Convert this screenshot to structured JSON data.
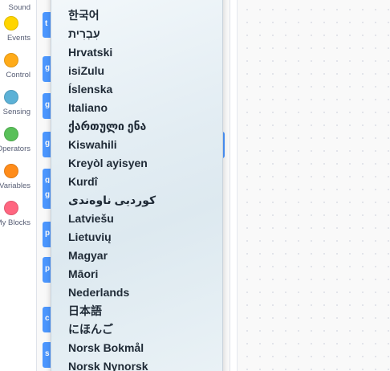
{
  "categories": [
    {
      "label": "Sound",
      "color": "#cf63cf"
    },
    {
      "label": "Events",
      "color": "#ffd500"
    },
    {
      "label": "Control",
      "color": "#ffab19"
    },
    {
      "label": "Sensing",
      "color": "#5cb1d6"
    },
    {
      "label": "Operators",
      "color": "#59c059"
    },
    {
      "label": "Variables",
      "color": "#ff8c1a"
    },
    {
      "label": "My Blocks",
      "color": "#ff6680"
    }
  ],
  "palette_blocks": [
    {
      "letter": "t",
      "color": "#4c97ff"
    },
    {
      "letter": "g",
      "color": "#4c97ff"
    },
    {
      "letter": "g",
      "color": "#4c97ff"
    },
    {
      "letter": "g",
      "color": "#4c97ff"
    },
    {
      "letter": "g",
      "color": "#4c97ff"
    },
    {
      "letter": "g",
      "color": "#4c97ff"
    },
    {
      "letter": "p",
      "color": "#4c97ff"
    },
    {
      "letter": "p",
      "color": "#4c97ff"
    },
    {
      "letter": "c",
      "color": "#4c97ff"
    },
    {
      "letter": "s",
      "color": "#4c97ff"
    }
  ],
  "language_menu": {
    "items": [
      "한국어",
      "עִבְרִית",
      "Hrvatski",
      "isiZulu",
      "Íslenska",
      "Italiano",
      "ქართული ენა",
      "Kiswahili",
      "Kreyòl ayisyen",
      "Kurdî",
      "کوردیی ناوەندی",
      "Latviešu",
      "Lietuvių",
      "Magyar",
      "Māori",
      "Nederlands",
      "日本語",
      "にほんご",
      "Norsk Bokmål",
      "Norsk Nynorsk"
    ]
  }
}
